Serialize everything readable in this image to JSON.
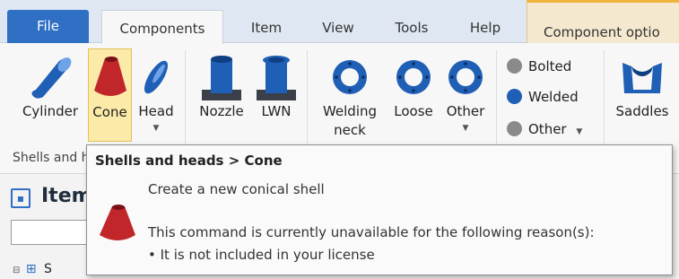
{
  "tabs": {
    "file": "File",
    "components": "Components",
    "item": "Item",
    "view": "View",
    "tools": "Tools",
    "help": "Help",
    "component_options": "Component optio"
  },
  "ribbon": {
    "buttons": {
      "cylinder": "Cylinder",
      "cone": "Cone",
      "head": "Head",
      "nozzle": "Nozzle",
      "lwn": "LWN",
      "welding_neck_line1": "Welding",
      "welding_neck_line2": "neck",
      "loose": "Loose",
      "other_flange": "Other",
      "saddles": "Saddles"
    },
    "small_options": {
      "bolted": "Bolted",
      "welded": "Welded",
      "other": "Other"
    },
    "group_label": "Shells and heads",
    "dropdown_arrow": "▼"
  },
  "panel": {
    "title": "Item",
    "tree_row": "S"
  },
  "tooltip": {
    "title": "Shells and heads > Cone",
    "description": "Create a new conical shell",
    "reason": "This command is currently unavailable for the following reason(s):",
    "bullet": "• It is not included in your license"
  },
  "colors": {
    "accent": "#2f6fc4",
    "selected_bg": "#fbeaa8",
    "cone_red": "#c0262a",
    "steel_blue": "#1f5fb5",
    "context_tab": "#f4e8cf"
  },
  "icons": {
    "cylinder": "cylinder-icon",
    "cone": "cone-icon",
    "head": "head-icon",
    "nozzle": "nozzle-icon",
    "lwn": "lwn-icon",
    "flange": "flange-icon",
    "saddle": "saddle-icon"
  }
}
